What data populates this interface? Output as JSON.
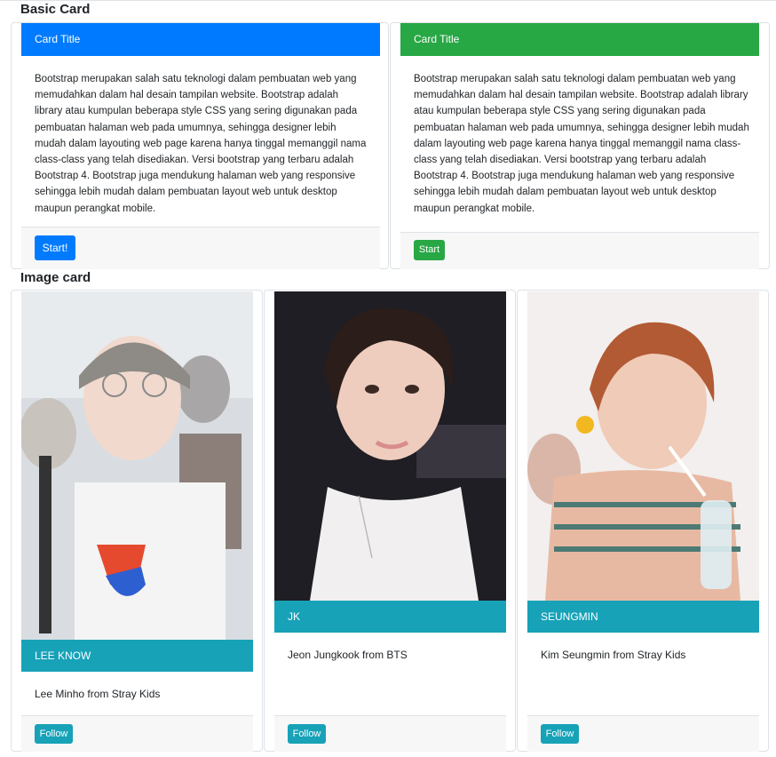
{
  "sections": {
    "basic_title": "Basic Card",
    "image_title": "Image card"
  },
  "basic_cards": [
    {
      "header": "Card Title",
      "header_color": "#007bff",
      "body": "Bootstrap merupakan salah satu teknologi dalam pembuatan web yang memudahkan dalam hal desain tampilan website. Bootstrap adalah library atau kumpulan beberapa style CSS yang sering digunakan pada pembuatan halaman web pada umumnya, sehingga designer lebih mudah dalam layouting web page karena hanya tinggal memanggil nama class-class yang telah disediakan. Versi bootstrap yang terbaru adalah Bootstrap 4. Bootstrap juga mendukung halaman web yang responsive sehingga lebih mudah dalam pembuatan layout web untuk desktop maupun perangkat mobile.",
      "button": "Start!",
      "button_color": "#007bff"
    },
    {
      "header": "Card Title",
      "header_color": "#28a745",
      "body": "Bootstrap merupakan salah satu teknologi dalam pembuatan web yang memudahkan dalam hal desain tampilan website. Bootstrap adalah library atau kumpulan beberapa style CSS yang sering digunakan pada pembuatan halaman web pada umumnya, sehingga designer lebih mudah dalam layouting web page karena hanya tinggal memanggil nama class-class yang telah disediakan. Versi bootstrap yang terbaru adalah Bootstrap 4. Bootstrap juga mendukung halaman web yang responsive sehingga lebih mudah dalam pembuatan layout web untuk desktop maupun perangkat mobile.",
      "button": "Start",
      "button_color": "#28a745"
    }
  ],
  "image_cards": [
    {
      "name": "LEE KNOW",
      "desc": "Lee Minho from Stray Kids",
      "button": "Follow"
    },
    {
      "name": "JK",
      "desc": "Jeon Jungkook from BTS",
      "button": "Follow"
    },
    {
      "name": "SEUNGMIN",
      "desc": "Kim Seungmin from Stray Kids",
      "button": "Follow"
    }
  ],
  "colors": {
    "info": "#17a2b8",
    "border": "#dee2e6",
    "footer_bg": "#f7f7f7"
  }
}
